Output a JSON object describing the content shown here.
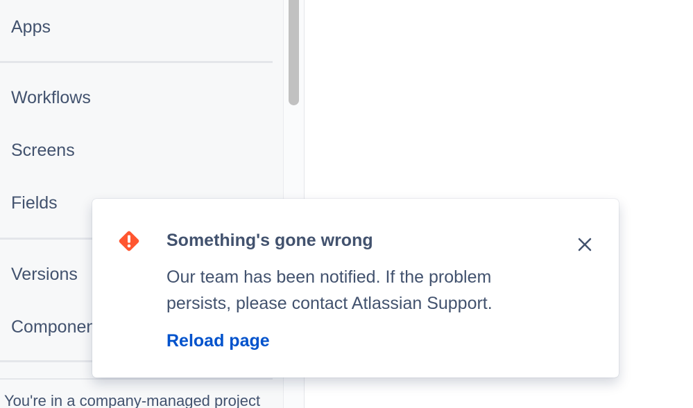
{
  "sidebar": {
    "items": [
      {
        "label": "Apps"
      },
      {
        "label": "Workflows"
      },
      {
        "label": "Screens"
      },
      {
        "label": "Fields"
      },
      {
        "label": "Versions"
      },
      {
        "label": "Components"
      }
    ],
    "footer_text": "You're in a company-managed project"
  },
  "flag": {
    "icon": "error-icon",
    "title": "Something's gone wrong",
    "description": "Our team has been notified. If the problem persists, please contact Atlassian Support.",
    "action_label": "Reload page",
    "close_icon": "close-icon"
  },
  "colors": {
    "text": "#42526e",
    "link": "#0052cc",
    "error": "#ff5630",
    "sidebar_bg": "#f7f8f9"
  }
}
